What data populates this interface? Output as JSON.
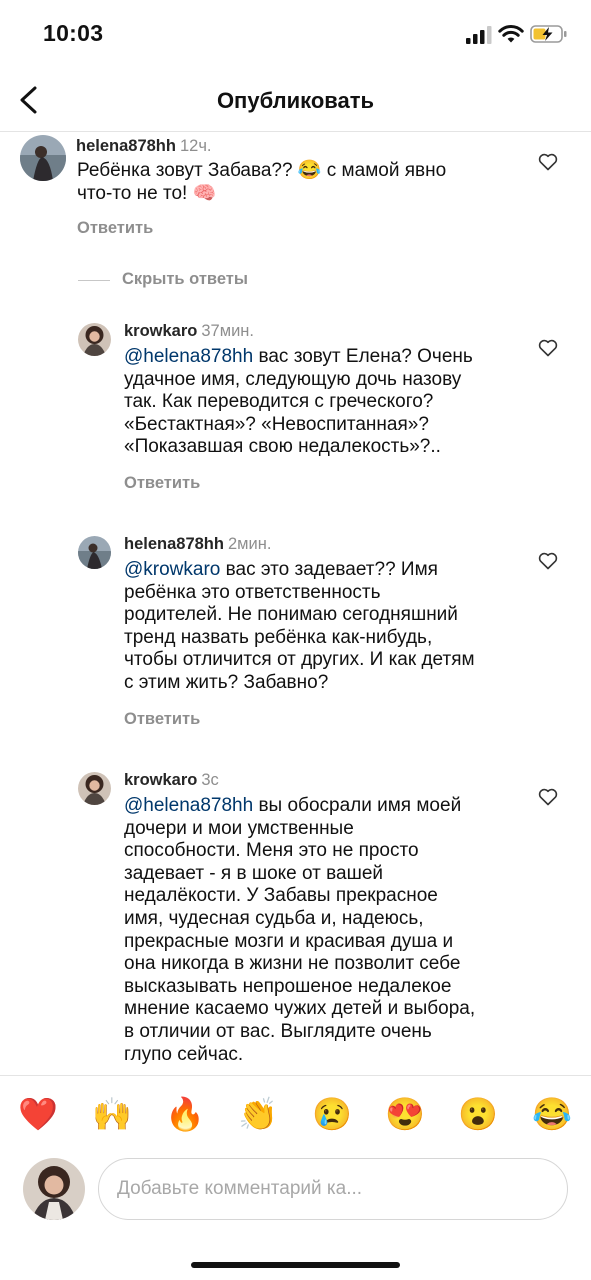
{
  "status_bar": {
    "time": "10:03"
  },
  "header": {
    "title": "Опубликовать"
  },
  "hide_replies_label": "Скрыть ответы",
  "comments": [
    {
      "username": "helena878hh",
      "time": "12ч.",
      "mention": "",
      "text": "Ребёнка зовут Забава?? 😂 с мамой явно\nчто-то не то! 🧠",
      "reply_label": "Ответить"
    },
    {
      "username": "krowkaro",
      "time": "37мин.",
      "mention": "@helena878hh",
      "text": " вас зовут Елена? Очень\nудачное имя, следующую дочь назову\nтак. Как переводится с греческого?\n«Бестактная»? «Невоспитанная»?\n«Показавшая свою недалекость»?..",
      "reply_label": "Ответить"
    },
    {
      "username": "helena878hh",
      "time": "2мин.",
      "mention": "@krowkaro",
      "text": " вас это задевает?? Имя\nребёнка это ответственность\nродителей.  Не понимаю сегодняшний\nтренд назвать ребёнка как-нибудь,\nчтобы отличится от других. И как детям\nс этим жить? Забавно?",
      "reply_label": "Ответить"
    },
    {
      "username": "krowkaro",
      "time": "3с",
      "mention": "@helena878hh",
      "text": " вы обосрали имя моей\nдочери и мои умственные\nспособности. Меня это не просто\nзадевает - я в шоке от вашей\nнедалёкости. У Забавы прекрасное\nимя, чудесная судьба и, надеюсь,\nпрекрасные мозги и красивая душа и\nона никогда в жизни не позволит себе\nвысказывать непрошеное недалекое\nмнение касаемо чужих детей и выбора,\nв отличии от вас. Выглядите очень\nглупо сейчас.",
      "reply_label": ""
    }
  ],
  "emoji_bar": [
    "❤️",
    "🙌",
    "🔥",
    "👏",
    "😢",
    "😍",
    "😮",
    "😂"
  ],
  "composer": {
    "placeholder": "Добавьте комментарий ка..."
  },
  "colors": {
    "mention": "#00376b",
    "secondary_text": "#8e8e8e",
    "divider": "#e4e4e4"
  }
}
